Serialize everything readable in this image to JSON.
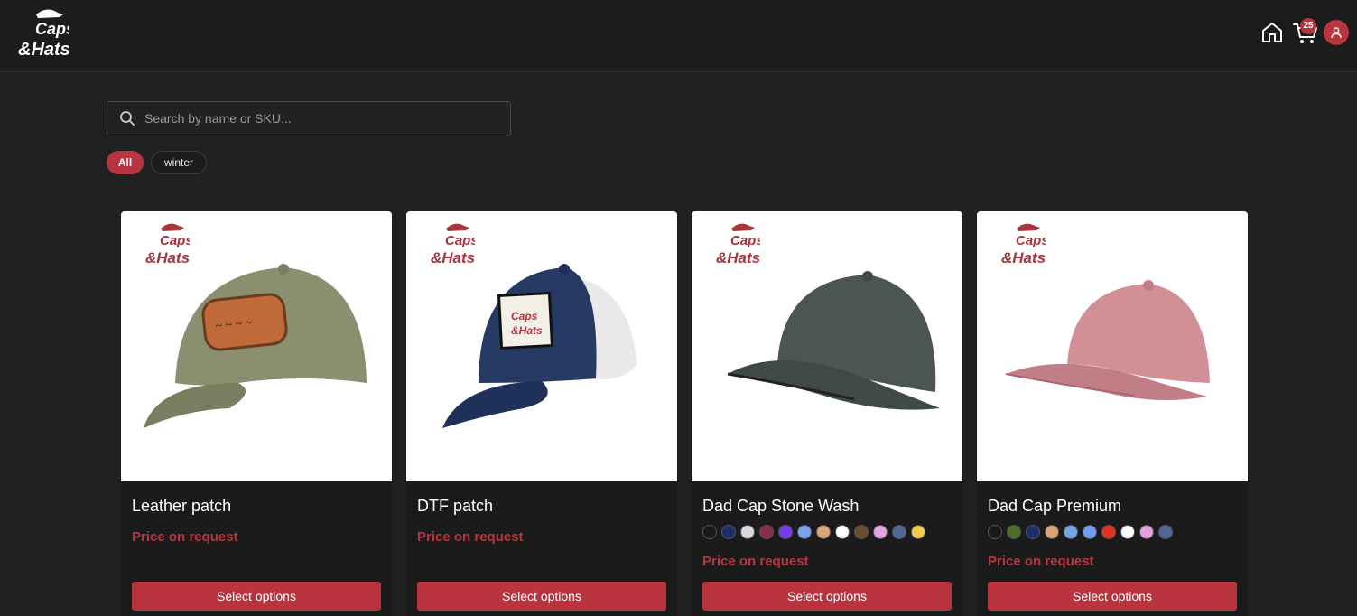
{
  "header": {
    "logo_text_1": "Caps",
    "logo_text_2": "&Hats",
    "cart_count": "25"
  },
  "search": {
    "placeholder": "Search by name or SKU..."
  },
  "filters": [
    {
      "label": "All",
      "active": true
    },
    {
      "label": "winter",
      "active": false
    }
  ],
  "products": [
    {
      "name": "Leather patch",
      "price": "Price on request",
      "button": "Select options",
      "cap_color": "#8b8e6f",
      "swatches": []
    },
    {
      "name": "DTF patch",
      "price": "Price on request",
      "button": "Select options",
      "cap_color": "#263a63",
      "swatches": []
    },
    {
      "name": "Dad Cap Stone Wash",
      "price": "Price on request",
      "button": "Select options",
      "cap_color": "#4a564f",
      "swatches": [
        "#1a1a1a",
        "#1f2f6b",
        "#d6d9df",
        "#8a2e45",
        "#7c3aed",
        "#74a3f0",
        "#d8a679",
        "#ffffff",
        "#6b4e2e",
        "#e5a1e0",
        "#4f6696",
        "#f1cc4f"
      ]
    },
    {
      "name": "Dad Cap Premium",
      "price": "Price on request",
      "button": "Select options",
      "cap_color": "#d18f96",
      "swatches": [
        "#1a1a1a",
        "#4b6e2a",
        "#1f2f6b",
        "#d8a679",
        "#74a3e8",
        "#6d9ef6",
        "#e0301e",
        "#ffffff",
        "#e5a1e0",
        "#4f6696"
      ]
    }
  ],
  "colors": {
    "accent": "#b8353f",
    "background": "#212121",
    "header": "#1c1c1c"
  }
}
